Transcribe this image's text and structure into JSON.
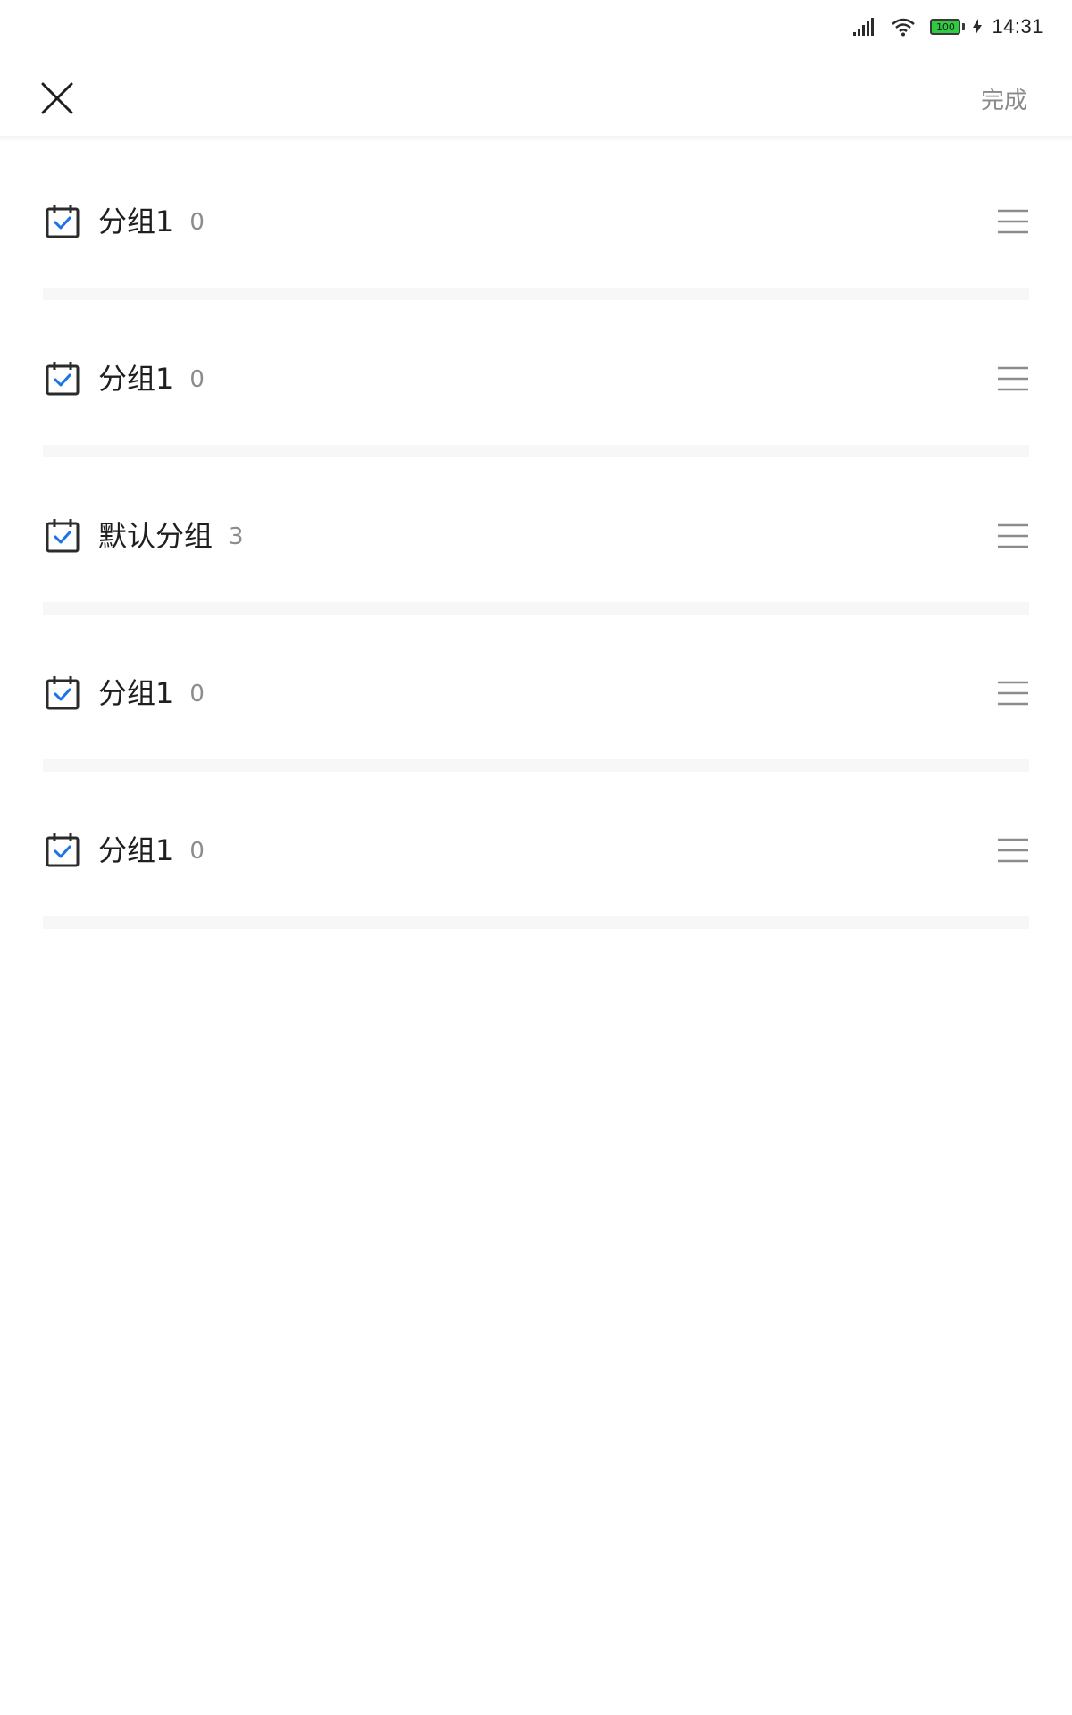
{
  "status_bar": {
    "time": "14:31",
    "battery": "100",
    "icons": [
      "signal-icon",
      "wifi-icon",
      "battery-icon",
      "charging-icon"
    ]
  },
  "header": {
    "close_icon": "close-icon",
    "done_label": "完成"
  },
  "groups": [
    {
      "name": "分组1",
      "count": "0"
    },
    {
      "name": "分组1",
      "count": "0"
    },
    {
      "name": "默认分组",
      "count": "3"
    },
    {
      "name": "分组1",
      "count": "0"
    },
    {
      "name": "分组1",
      "count": "0"
    }
  ],
  "colors": {
    "accent": "#1a73e8",
    "icon_dark": "#2b2b2b",
    "text_primary": "#1f1f1f",
    "text_secondary": "#8c8c8c",
    "separator": "#f7f7f7",
    "battery_fill": "#2ecc40"
  }
}
